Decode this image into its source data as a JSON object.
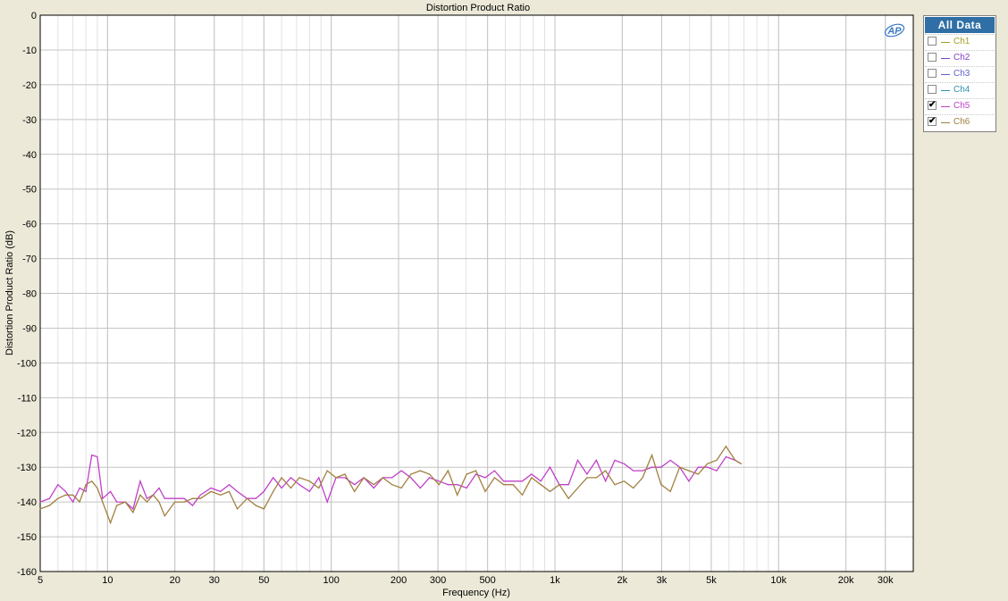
{
  "chart_data": {
    "type": "line",
    "title": "Distortion Product Ratio",
    "xlabel": "Frequency (Hz)",
    "ylabel": "Distortion Product Ratio (dB)",
    "x_scale": "log",
    "xlim": [
      5,
      40000
    ],
    "ylim": [
      -160,
      0
    ],
    "grid": true,
    "legend_position": "right",
    "x_ticks": [
      {
        "value": 5,
        "label": "5"
      },
      {
        "value": 10,
        "label": "10"
      },
      {
        "value": 20,
        "label": "20"
      },
      {
        "value": 30,
        "label": "30"
      },
      {
        "value": 50,
        "label": "50"
      },
      {
        "value": 100,
        "label": "100"
      },
      {
        "value": 200,
        "label": "200"
      },
      {
        "value": 300,
        "label": "300"
      },
      {
        "value": 500,
        "label": "500"
      },
      {
        "value": 1000,
        "label": "1k"
      },
      {
        "value": 2000,
        "label": "2k"
      },
      {
        "value": 3000,
        "label": "3k"
      },
      {
        "value": 5000,
        "label": "5k"
      },
      {
        "value": 10000,
        "label": "10k"
      },
      {
        "value": 20000,
        "label": "20k"
      },
      {
        "value": 30000,
        "label": "30k"
      }
    ],
    "y_ticks": [
      0,
      -10,
      -20,
      -30,
      -40,
      -50,
      -60,
      -70,
      -80,
      -90,
      -100,
      -110,
      -120,
      -130,
      -140,
      -150,
      -160
    ],
    "series": [
      {
        "name": "Ch5",
        "color": "#c040c8",
        "x": [
          5,
          5.5,
          6,
          6.5,
          7,
          7.5,
          8,
          8.5,
          9,
          9.5,
          10.3,
          11,
          12,
          13,
          14,
          15,
          16,
          17,
          18,
          20,
          22,
          24,
          26,
          29,
          32,
          35,
          38,
          42,
          46,
          50,
          55,
          60,
          66,
          72,
          80,
          88,
          96,
          105,
          115,
          127,
          140,
          155,
          170,
          187,
          206,
          227,
          250,
          275,
          303,
          333,
          366,
          403,
          443,
          488,
          537,
          590,
          650,
          715,
          786,
          865,
          951,
          1046,
          1150,
          1265,
          1392,
          1531,
          1684,
          1853,
          2038,
          2242,
          2466,
          2713,
          2984,
          3282,
          3611,
          3972,
          4369,
          4806,
          5287,
          5815,
          6397,
          6800
        ],
        "values": [
          -140,
          -139,
          -135,
          -137,
          -140,
          -136,
          -137,
          -126.5,
          -127,
          -139,
          -137,
          -140,
          -140,
          -142,
          -134,
          -139,
          -138,
          -136,
          -139,
          -139,
          -139,
          -141,
          -138,
          -136,
          -137,
          -135,
          -137,
          -139,
          -139,
          -137,
          -133,
          -136,
          -133,
          -135,
          -137,
          -133,
          -140,
          -133,
          -133,
          -135,
          -133,
          -136,
          -133,
          -133,
          -131,
          -133,
          -136,
          -133,
          -134,
          -135,
          -135,
          -136,
          -132,
          -133,
          -131,
          -134,
          -134,
          -134,
          -132,
          -134,
          -130,
          -135,
          -135,
          -128,
          -132,
          -128,
          -134,
          -128,
          -129,
          -131,
          -131,
          -130,
          -130,
          -128,
          -130,
          -134,
          -130,
          -130,
          -131,
          -127,
          -128,
          -129
        ]
      },
      {
        "name": "Ch6",
        "color": "#a08040",
        "x": [
          5,
          5.5,
          6,
          6.5,
          7,
          7.5,
          8,
          8.5,
          9,
          9.5,
          10.3,
          11,
          12,
          13,
          14,
          15,
          16,
          17,
          18,
          20,
          22,
          24,
          26,
          29,
          32,
          35,
          38,
          42,
          46,
          50,
          55,
          60,
          66,
          72,
          80,
          88,
          96,
          105,
          115,
          127,
          140,
          155,
          170,
          187,
          206,
          227,
          250,
          275,
          303,
          333,
          366,
          403,
          443,
          488,
          537,
          590,
          650,
          715,
          786,
          865,
          951,
          1046,
          1150,
          1265,
          1392,
          1531,
          1684,
          1853,
          2038,
          2242,
          2466,
          2713,
          2984,
          3282,
          3611,
          3972,
          4369,
          4806,
          5287,
          5815,
          6397,
          6800
        ],
        "values": [
          -142,
          -141,
          -139,
          -138,
          -138,
          -140,
          -135,
          -134,
          -136,
          -140,
          -146,
          -141,
          -140,
          -143,
          -138,
          -140,
          -138,
          -140,
          -144,
          -140,
          -140,
          -139,
          -139,
          -137,
          -138,
          -137,
          -142,
          -139,
          -141,
          -142,
          -137,
          -133,
          -136,
          -133,
          -134,
          -136,
          -131,
          -133,
          -132,
          -137,
          -133,
          -135,
          -133,
          -135,
          -136,
          -132,
          -131,
          -132,
          -135,
          -131,
          -138,
          -132,
          -131,
          -137,
          -133,
          -135,
          -135,
          -138,
          -133,
          -135,
          -137,
          -135,
          -139,
          -136,
          -133,
          -133,
          -131,
          -135,
          -134,
          -136,
          -133,
          -126.5,
          -135,
          -137,
          -130,
          -131,
          -132,
          -129,
          -128,
          -124,
          -128,
          -129
        ]
      }
    ]
  },
  "legend": {
    "header": "All Data",
    "items": [
      {
        "label": "Ch1",
        "color": "#a0a020",
        "checked": false,
        "check": ""
      },
      {
        "label": "Ch2",
        "color": "#8040c8",
        "checked": false,
        "check": ""
      },
      {
        "label": "Ch3",
        "color": "#6060d0",
        "checked": false,
        "check": ""
      },
      {
        "label": "Ch4",
        "color": "#3090b0",
        "checked": false,
        "check": ""
      },
      {
        "label": "Ch5",
        "color": "#c040c8",
        "checked": true,
        "check": "✔"
      },
      {
        "label": "Ch6",
        "color": "#a08040",
        "checked": true,
        "check": "✔"
      }
    ]
  },
  "logo": {
    "text": "AP",
    "color": "#3a7bc8"
  }
}
